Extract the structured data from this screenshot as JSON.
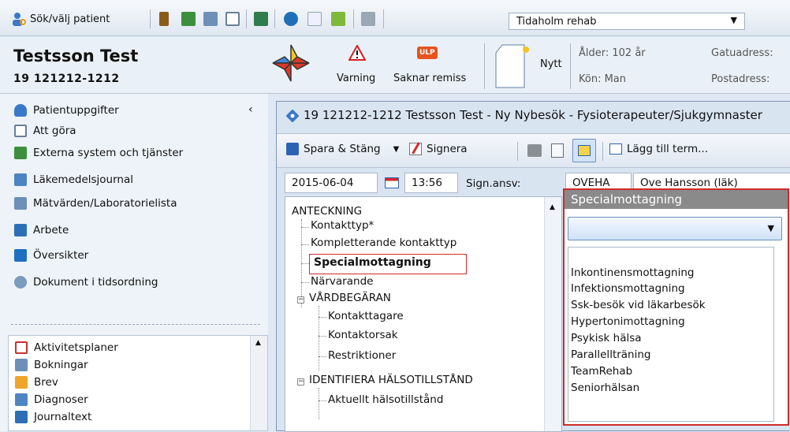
{
  "toolbar": {
    "search_patient_label": "Sök/välj patient",
    "unit_selected": "Tidaholm rehab"
  },
  "patient": {
    "name": "Testsson Test",
    "id": "19 121212-1212",
    "warning_label": "Varning",
    "ulp_badge": "ULP",
    "missing_referral_label": "Saknar remiss",
    "new_label": "Nytt",
    "age_label": "Ålder: 102 år",
    "gender_label": "Kön: Man",
    "street_label": "Gatuadress:",
    "postal_label": "Postadress:"
  },
  "sidebar": {
    "items": [
      {
        "label": "Patientuppgifter"
      },
      {
        "label": "Att göra"
      },
      {
        "label": "Externa system och tjänster"
      },
      {
        "label": "Läkemedelsjournal"
      },
      {
        "label": "Mätvärden/Laboratorielista"
      },
      {
        "label": "Arbete"
      },
      {
        "label": "Översikter"
      },
      {
        "label": "Dokument i tidsordning"
      }
    ],
    "sub_items": [
      {
        "label": "Aktivitetsplaner"
      },
      {
        "label": "Bokningar"
      },
      {
        "label": "Brev"
      },
      {
        "label": "Diagnoser"
      },
      {
        "label": "Journaltext"
      }
    ]
  },
  "dialog": {
    "title": "19 121212-1212 Testsson Test - Ny Nybesök - Fysioterapeuter/Sjukgymnaster",
    "save_close_label": "Spara & Stäng",
    "sign_label": "Signera",
    "add_term_label": "Lägg till term...",
    "date": "2015-06-04",
    "time": "13:56",
    "sign_resp_label": "Sign.ansv:",
    "sign_code": "OVEHA",
    "sign_name": "Ove Hansson (läk)"
  },
  "tree": {
    "root": "ANTECKNING",
    "nodes": [
      "Kontakttyp*",
      "Kompletterande kontakttyp",
      "Specialmottagning",
      "Närvarande",
      "VÅRDBEGÄRAN",
      "Kontakttagare",
      "Kontaktorsak",
      "Restriktioner",
      "IDENTIFIERA HÄLSOTILLSTÅND",
      "Aktuellt hälsotillstånd"
    ]
  },
  "spec_panel": {
    "title": "Specialmottagning",
    "selected": "",
    "options": [
      "Inkontinensmottagning",
      "Infektionsmottagning",
      "Ssk-besök vid läkarbesök",
      "Hypertonimottagning",
      "Psykisk hälsa",
      "Parallellträning",
      "TeamRehab",
      "Seniorhälsan"
    ]
  }
}
